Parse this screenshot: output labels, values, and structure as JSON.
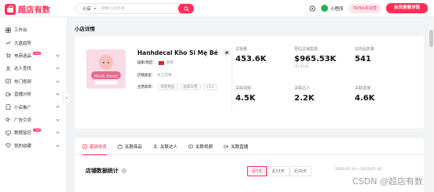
{
  "app": {
    "logo_text": "超店有数",
    "colors": {
      "brand": "#ff2d55",
      "success": "#22b24c"
    }
  },
  "header": {
    "search_type": "小店",
    "search_placeholder": "搜索小店名称",
    "mini_program": "小程序",
    "tiktok_label": "TikTok实战营",
    "vip_label": "会员套餐详情"
  },
  "sidebar": {
    "items": [
      {
        "label": "工作台",
        "icon": "dashboard-icon",
        "badge": "",
        "expandable": false
      },
      {
        "label": "大盘趋势",
        "icon": "trend-icon",
        "badge": "",
        "expandable": false
      },
      {
        "label": "电商选品",
        "icon": "cart-icon",
        "badge": "new",
        "expandable": true
      },
      {
        "label": "达人查找",
        "icon": "user-icon",
        "badge": "",
        "expandable": true
      },
      {
        "label": "热门视频",
        "icon": "video-icon",
        "badge": "",
        "expandable": true
      },
      {
        "label": "直播分析",
        "icon": "live-icon",
        "badge": "",
        "expandable": true
      },
      {
        "label": "小店推广",
        "icon": "shop-icon",
        "badge": "",
        "expandable": true
      },
      {
        "label": "广告引流",
        "icon": "ad-icon",
        "badge": "",
        "expandable": true
      },
      {
        "label": "数据监控",
        "icon": "monitor-icon",
        "badge": "new",
        "expandable": true
      },
      {
        "label": "我的收藏",
        "icon": "heart-icon",
        "badge": "",
        "expandable": true
      }
    ]
  },
  "page": {
    "title": "小店详情"
  },
  "shop": {
    "name": "Hanhdecal Kho Si Mẹ Bé",
    "image_text": "Hanh Decal",
    "region_label": "国家/地区：",
    "region_value": "越南",
    "category_label": "店铺类型：",
    "category_value": "本土店铺",
    "main_category_label": "主营类目：",
    "tags": [
      "母婴用品",
      "居家日用",
      "+13"
    ]
  },
  "stats": [
    {
      "label": "总销量",
      "value": "453.6K",
      "sub": ""
    },
    {
      "label": "预估总销售额",
      "value": "$965.53K",
      "sub": "(22.6亿₫)"
    },
    {
      "label": "总商品数量",
      "value": "541",
      "sub": ""
    },
    {
      "label": "关联视频",
      "value": "4.5K",
      "sub": ""
    },
    {
      "label": "关联达人",
      "value": "2.2K",
      "sub": ""
    },
    {
      "label": "关联直播",
      "value": "4.6K",
      "sub": ""
    }
  ],
  "tabs": [
    {
      "label": "基础信息",
      "icon": "info-icon",
      "active": true
    },
    {
      "label": "关联商品",
      "icon": "box-icon",
      "active": false
    },
    {
      "label": "关联达人",
      "icon": "user-icon",
      "active": false
    },
    {
      "label": "关联视频",
      "icon": "video-icon",
      "active": false
    },
    {
      "label": "关联直播",
      "icon": "live-icon",
      "active": false
    }
  ],
  "section": {
    "title": "店铺数据统计",
    "ranges": [
      "近7天",
      "近15天",
      "近30天"
    ],
    "active_range": 0,
    "date_range": "2022-07-24 ~ 2022-07-30"
  },
  "watermark": "CSDN @超店有数"
}
